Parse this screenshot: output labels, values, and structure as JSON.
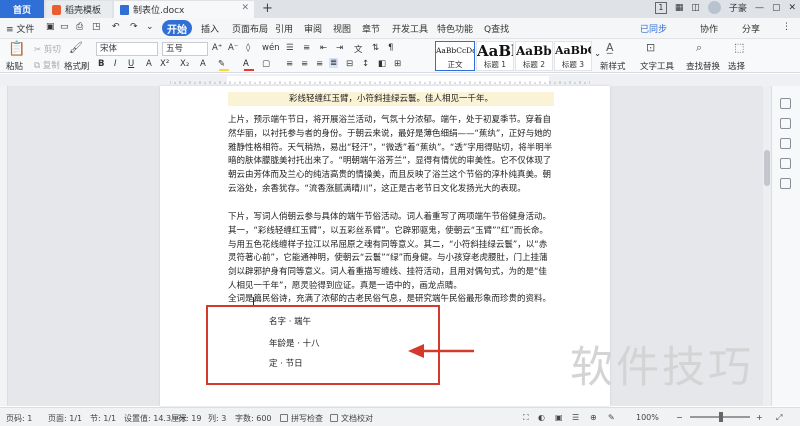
{
  "titlebar": {
    "home_tab": "首页",
    "templates_tab": "稻壳模板",
    "doc_tab": "制表位.docx",
    "new_tab": "+",
    "badge": "1",
    "user": "子豪"
  },
  "menubar": {
    "file": "≡ 文件",
    "items": [
      "开始",
      "插入",
      "页面布局",
      "引用",
      "审阅",
      "视图",
      "章节",
      "开发工具",
      "特色功能"
    ],
    "search": "Q查找",
    "sync": "已同步",
    "collab": "协作",
    "share": "分享"
  },
  "ribbon": {
    "paste": "粘贴",
    "cut": "剪切",
    "copy": "复制",
    "format_painter": "格式刷",
    "font_name": "宋体",
    "font_size": "五号",
    "styles": [
      {
        "sample": "AaBbCcDd",
        "name": "正文"
      },
      {
        "sample": "AaBl",
        "name": "标题 1"
      },
      {
        "sample": "AaBbC",
        "name": "标题 2"
      },
      {
        "sample": "AaBbC",
        "name": "标题 3"
      }
    ],
    "new_style": "新样式",
    "text_tool": "文字工具",
    "find_replace": "查找替换",
    "select": "选择"
  },
  "document": {
    "highlight_line": "彩线轻缠红玉臂，小符斜挂绿云鬟。佳人相见一千年。",
    "para1": "上片，预示端午节日，将开展浴兰活动，气氛十分浓郁。端午，处于初夏季节。穿着自然华丽，以衬托参与者的身份。于朝云来说，最好是薄色细绢——“蕉纨”，正好与她的雅静性格相符。天气稍热，易出“轻汗”，“微透”着“蕉纨”。“透”字用得贴切，将半明半暗的肤体朦胧美衬托出来了。“明朝端午浴芳兰”，显得有情优的审美性。它不仅体现了朝云由芳体而及兰心的纯洁高贵的情操美，而且反映了浴兰这个节俗的淳朴纯真美。朝云浴处，余香犹存。“流香涨腻满晴川”，这正是古老节日文化发扬光大的表现。",
    "para2": "下片，写词人俏朝云参与具体的端午节俗活动。词人着重写了两项端午节俗健身活动。其一，“彩线轻缠红玉臂”，以五彩丝系臂”。它辟邪驱鬼，使朝云“玉臂”“红”而长命。与用五色花线缠样子拉江以吊屈原之魂有同等意义。其二，“小符斜挂绿云鬟”，以“赤灵符著心前”，它能通神明，使朝云“云鬟”“绿”而身健。与小孩穿老虎腰肚，门上挂蒲剑以辟邪护身有同等意义。词人着重描写缠线、挂符活动，且用对偶句式，为的是“佳人相见一千年”，愿灵验得到应证。真是一语中的，画龙点睛。",
    "last_line": "全词是篇民俗诗，充满了浓郁的古老民俗气息，是研究端午民俗最形象而珍贵的资料。",
    "fields": [
      "名字 · 端午",
      "年龄是 · 十八",
      "定 · 节日"
    ]
  },
  "watermark": "软件技巧",
  "statusbar": {
    "page_no": "页码: 1",
    "page": "页面: 1/1",
    "section": "节: 1/1",
    "setting": "设置值: 14.3厘米",
    "row": "行: 19",
    "col": "列: 3",
    "word_count": "字数: 600",
    "spell_check": "拼写检查",
    "doc_check": "文档校对",
    "zoom_pct": "100%"
  },
  "colors": {
    "accent": "#2f6fd6",
    "annotation_red": "#d33a2c",
    "highlight": "#fbf3d6"
  }
}
